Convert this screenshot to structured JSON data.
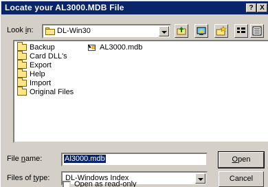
{
  "window": {
    "title": "Locate your AL3000.MDB File",
    "help_button": "?",
    "close_button": "X"
  },
  "look_in": {
    "label_pre": "Look ",
    "label_access": "i",
    "label_post": "n:",
    "value": "DL-Win30"
  },
  "toolbar": {
    "icons": [
      "up-folder-icon",
      "desktop-icon",
      "new-folder-icon",
      "list-view-icon",
      "details-view-icon"
    ]
  },
  "files": {
    "folders": [
      "Backup",
      "Card DLL's",
      "Export",
      "Help",
      "Import",
      "Original Files"
    ],
    "databases": [
      "AL3000.mdb"
    ]
  },
  "file_name": {
    "label_pre": "File ",
    "label_access": "n",
    "label_post": "ame:",
    "value": "Al3000.mdb"
  },
  "files_of_type": {
    "label_pre": "Files of ",
    "label_access": "t",
    "label_post": "ype:",
    "value": "DL-Windows Index"
  },
  "buttons": {
    "open_access": "O",
    "open_rest": "pen",
    "cancel": "Cancel"
  },
  "readonly": {
    "label_pre": "Open as ",
    "label_access": "r",
    "label_post": "ead-only",
    "checked": false
  },
  "colors": {
    "titlebar": "#0a246a",
    "face": "#d4d0c8",
    "selection": "#0a246a",
    "folder": "#ffe68a"
  }
}
